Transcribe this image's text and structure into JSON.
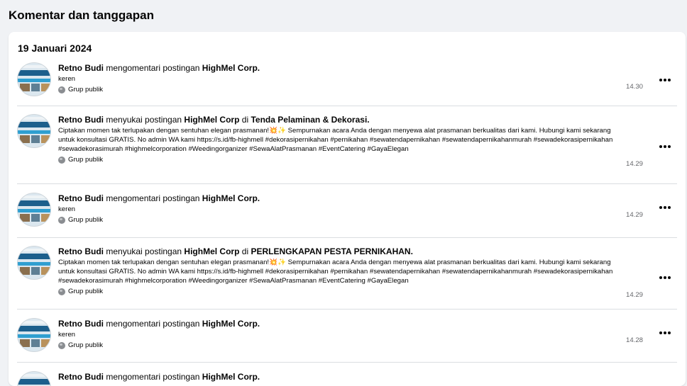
{
  "page": {
    "title": "Komentar dan tanggapan"
  },
  "section": {
    "date": "19 Januari 2024"
  },
  "items": [
    {
      "actor": "Retno Budi",
      "action": "mengomentari postingan",
      "target": "HighMel Corp.",
      "group_prefix": "",
      "group": "",
      "snippet": "keren",
      "audience": "Grup publik",
      "time": "14.30"
    },
    {
      "actor": "Retno Budi",
      "action": "menyukai postingan",
      "target": "HighMel Corp",
      "group_prefix": "di",
      "group": "Tenda Pelaminan & Dekorasi.",
      "snippet": "Ciptakan momen tak terlupakan dengan sentuhan elegan prasmanan!💥✨ Sempurnakan acara Anda dengan menyewa alat prasmanan berkualitas dari kami. Hubungi kami sekarang untuk konsultasi GRATIS. No admin WA kami https://s.id/fb-highmell #dekorasipernikahan #pernikahan #sewatendapernikahan #sewatendapernikahanmurah #sewadekorasipernikahan #sewadekorasimurah #highmelcorporation #Weedingorganizer #SewaAlatPrasmanan #EventCatering #GayaElegan",
      "audience": "Grup publik",
      "time": "14.29"
    },
    {
      "actor": "Retno Budi",
      "action": "mengomentari postingan",
      "target": "HighMel Corp.",
      "group_prefix": "",
      "group": "",
      "snippet": "keren",
      "audience": "Grup publik",
      "time": "14.29"
    },
    {
      "actor": "Retno Budi",
      "action": "menyukai postingan",
      "target": "HighMel Corp",
      "group_prefix": "di",
      "group": "PERLENGKAPAN PESTA PERNIKAHAN.",
      "snippet": "Ciptakan momen tak terlupakan dengan sentuhan elegan prasmanan!💥✨ Sempurnakan acara Anda dengan menyewa alat prasmanan berkualitas dari kami. Hubungi kami sekarang untuk konsultasi GRATIS. No admin WA kami https://s.id/fb-highmell #dekorasipernikahan #pernikahan #sewatendapernikahan #sewatendapernikahanmurah #sewadekorasipernikahan #sewadekorasimurah #highmelcorporation #Weedingorganizer #SewaAlatPrasmanan #EventCatering #GayaElegan",
      "audience": "Grup publik",
      "time": "14.29"
    },
    {
      "actor": "Retno Budi",
      "action": "mengomentari postingan",
      "target": "HighMel Corp.",
      "group_prefix": "",
      "group": "",
      "snippet": "keren",
      "audience": "Grup publik",
      "time": "14.28"
    },
    {
      "actor": "Retno Budi",
      "action": "mengomentari postingan",
      "target": "HighMel Corp.",
      "group_prefix": "",
      "group": "",
      "snippet": "",
      "audience": "",
      "time": ""
    }
  ],
  "icons": {
    "audience": "globe-icon",
    "menu": "more-options-icon"
  },
  "colors": {
    "background": "#f0f2f5",
    "card": "#ffffff",
    "divider": "#dadde1",
    "secondary_text": "#65676b"
  }
}
